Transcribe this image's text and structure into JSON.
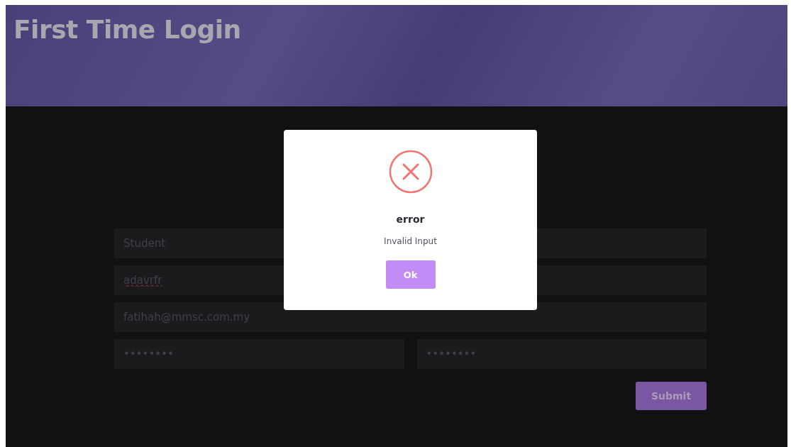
{
  "header": {
    "title": "First Time Login"
  },
  "form": {
    "rows": [
      {
        "fields": [
          {
            "value": "Student",
            "misspelled": false
          }
        ]
      },
      {
        "fields": [
          {
            "value": "adavrfr",
            "misspelled": true
          }
        ]
      },
      {
        "fields": [
          {
            "value": "fatihah@mmsc.com.my",
            "misspelled": false
          }
        ]
      },
      {
        "fields": [
          {
            "value": "••••••••",
            "misspelled": false
          },
          {
            "value": "••••••••",
            "misspelled": false
          }
        ]
      }
    ],
    "submit": "Submit"
  },
  "dialog": {
    "kind": "error",
    "title": "error",
    "message": "Invalid Input",
    "button": "Ok"
  }
}
